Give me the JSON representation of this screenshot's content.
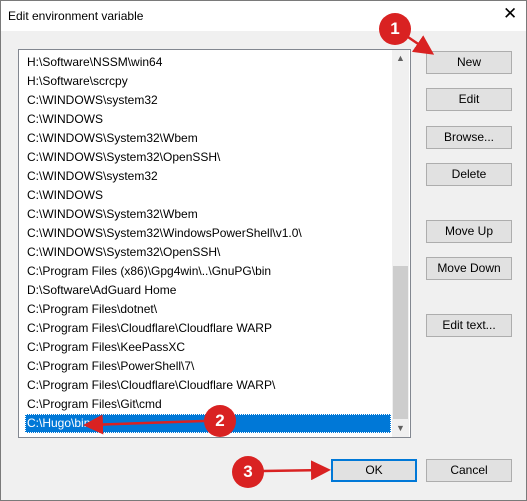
{
  "window": {
    "title": "Edit environment variable",
    "close_glyph": "✕"
  },
  "list": {
    "items": [
      "H:\\Software\\NSSM\\win64",
      "H:\\Software\\scrcpy",
      "C:\\WINDOWS\\system32",
      "C:\\WINDOWS",
      "C:\\WINDOWS\\System32\\Wbem",
      "C:\\WINDOWS\\System32\\OpenSSH\\",
      "C:\\WINDOWS\\system32",
      "C:\\WINDOWS",
      "C:\\WINDOWS\\System32\\Wbem",
      "C:\\WINDOWS\\System32\\WindowsPowerShell\\v1.0\\",
      "C:\\WINDOWS\\System32\\OpenSSH\\",
      "C:\\Program Files (x86)\\Gpg4win\\..\\GnuPG\\bin",
      "D:\\Software\\AdGuard Home",
      "C:\\Program Files\\dotnet\\",
      "C:\\Program Files\\Cloudflare\\Cloudflare WARP",
      "C:\\Program Files\\KeePassXC",
      "C:\\Program Files\\PowerShell\\7\\",
      "C:\\Program Files\\Cloudflare\\Cloudflare WARP\\",
      "C:\\Program Files\\Git\\cmd",
      "C:\\Hugo\\bin"
    ],
    "selected_index": 19
  },
  "buttons": {
    "new": "New",
    "edit": "Edit",
    "browse": "Browse...",
    "delete": "Delete",
    "move_up": "Move Up",
    "move_down": "Move Down",
    "edit_text": "Edit text...",
    "ok": "OK",
    "cancel": "Cancel"
  },
  "annotations": {
    "badge1": "1",
    "badge2": "2",
    "badge3": "3",
    "color": "#d92222"
  },
  "icons": {
    "scroll_up": "scroll-up-arrow-icon",
    "scroll_down": "scroll-down-arrow-icon"
  }
}
